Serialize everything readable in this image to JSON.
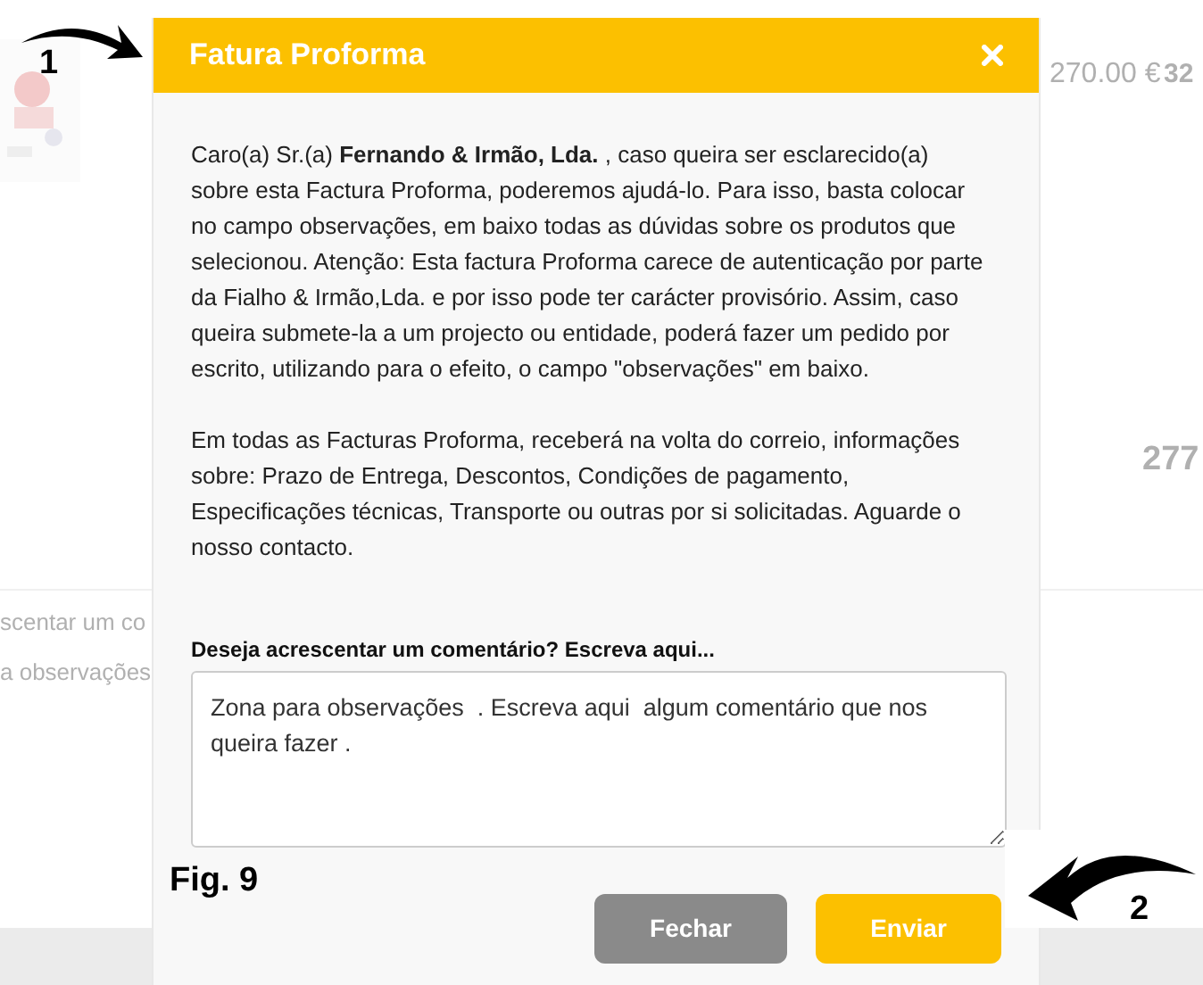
{
  "background": {
    "price": "270.00 €",
    "column_2": "32",
    "total": "277",
    "comment_label": "scentar um co",
    "comment_field": "a observações"
  },
  "modal": {
    "title": "Fatura Proforma",
    "paragraphs": [
      "Caro(a) Sr.(a) **Fernando & Irmão, Lda.** , caso queira ser esclarecido(a) sobre esta Factura Proforma, poderemos ajudá-lo. Para isso, basta colocar no campo observações, em baixo todas as dúvidas sobre os produtos que selecionou. Atenção: Esta factura Proforma carece de autenticação por parte da Fialho & Irmão,Lda. e por isso pode ter carácter provisório. Assim, caso queira submete-la a um projecto ou entidade, poderá fazer um pedido por escrito, utilizando para o efeito, o campo \"observações\" em baixo.",
      "Em todas as Facturas Proforma, receberá na volta do correio, informações sobre: Prazo de Entrega, Descontos, Condições de pagamento, Especificações técnicas, Transporte ou outras por si solicitadas. Aguarde o nosso contacto."
    ],
    "comment_label": "Deseja acrescentar um comentário? Escreva aqui...",
    "comment_value": "Zona para observações  . Escreva aqui  algum comentário que nos queira fazer .",
    "buttons": [
      {
        "label": "Fechar",
        "kind": "secondary"
      },
      {
        "label": "Enviar",
        "kind": "primary"
      }
    ]
  },
  "annotations": [
    {
      "label": "1"
    },
    {
      "label": "2"
    }
  ],
  "figure_caption": "Fig. 9"
}
